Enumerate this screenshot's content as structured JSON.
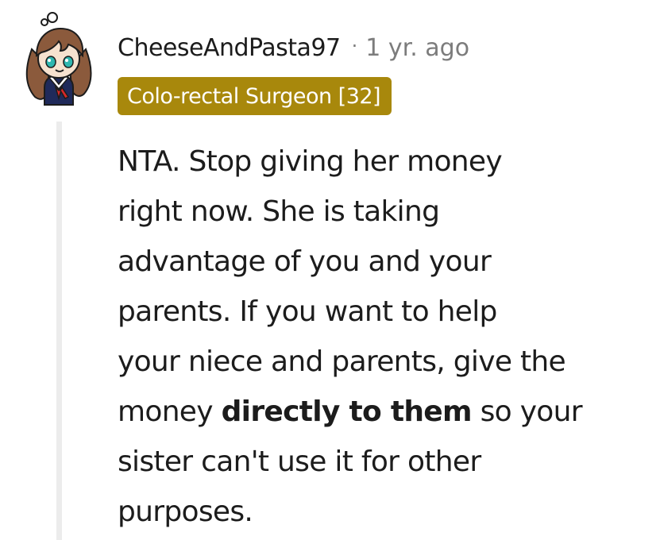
{
  "comment": {
    "username": "CheeseAndPasta97",
    "separator": "·",
    "timestamp": "1 yr. ago",
    "flair": "Colo-rectal Surgeon [32]",
    "body": {
      "line1": "NTA. Stop giving her money",
      "line2": "right now. She is taking",
      "line3": "advantage of you and your",
      "line4": "parents. If you want to help",
      "line5": "your niece and parents, give the",
      "line6_before": "money ",
      "line6_bold": "directly to them",
      "line6_after": " so your",
      "line7": "sister can't use it for other",
      "line8": "purposes."
    }
  },
  "avatar": {
    "icon": "user-avatar-chibi-girl-sailor-uniform"
  },
  "colors": {
    "flair_background": "#a8880c",
    "flair_text": "#ffffff",
    "timestamp": "#7c7c7c",
    "thread_line": "#ececec",
    "body_text": "#1c1c1c"
  }
}
